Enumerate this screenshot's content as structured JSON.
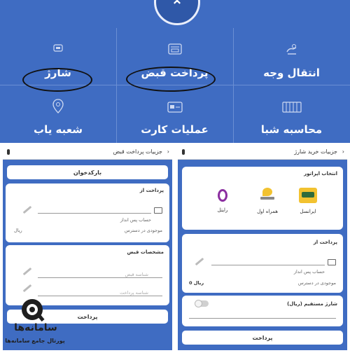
{
  "top_grid": {
    "row1": [
      {
        "label": "شارژ",
        "icon": "charge-icon"
      },
      {
        "label": "پرداخت قبض",
        "icon": "bill-payment-icon"
      },
      {
        "label": "انتقال وجه",
        "icon": "money-transfer-icon"
      }
    ],
    "row2": [
      {
        "label": "شعبه یاب",
        "icon": "map-pin-icon"
      },
      {
        "label": "عملیات کارت",
        "icon": "card-operations-icon"
      },
      {
        "label": "محاسبه شبا",
        "icon": "calculator-icon"
      }
    ]
  },
  "left_panel": {
    "header": "جزییات پرداخت قبض",
    "barcode_button": "بارکدخوان",
    "pay_from_title": "پرداخت از",
    "account_hint": "حساب پس انداز",
    "balance_label": "موجودی در دسترس",
    "currency": "ریال",
    "bill_specs_title": "مشخصات قبض",
    "bill_id_placeholder": "شناسه قبض",
    "payment_id_placeholder": "شناسه پرداخت",
    "pay_button": "پرداخت"
  },
  "right_panel": {
    "header": "جزییات خرید شارژ",
    "operator_title": "انتخاب اپراتور",
    "operators": [
      "ایرانسل",
      "همراه اول",
      "رایتل"
    ],
    "pay_from_title": "پرداخت از",
    "account_hint": "حساب پس انداز",
    "balance_label": "موجودی در دسترس",
    "balance_value": "0 ریال",
    "direct_charge_label": "شارژ مستقیم (ریال)",
    "pay_button": "پرداخت"
  },
  "watermark": {
    "brand": "سامانه‌ها",
    "tagline": "پورتال جامع سامانه‌ها"
  },
  "colors": {
    "primary_blue": "#3f6cc2",
    "irancell_yellow": "#f2c230",
    "rightel_purple": "#8b2fa0"
  }
}
